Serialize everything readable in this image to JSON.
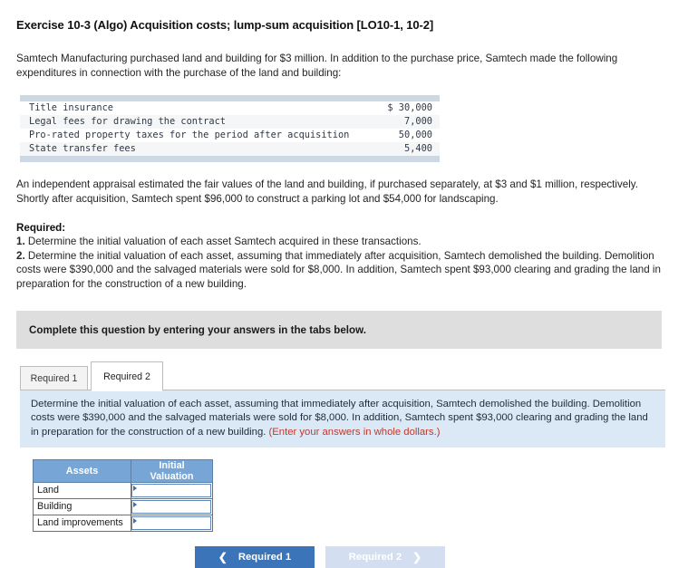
{
  "exercise": {
    "title": "Exercise 10-3 (Algo) Acquisition costs; lump-sum acquisition [LO10-1, 10-2]"
  },
  "intro": {
    "paragraph": "Samtech Manufacturing purchased land and building for $3 million. In addition to the purchase price, Samtech made the following expenditures in connection with the purchase of the land and building:"
  },
  "expenditures_table": {
    "rows": [
      {
        "description": "Title insurance",
        "amount": "$ 30,000"
      },
      {
        "description": "Legal fees for drawing the contract",
        "amount": "7,000"
      },
      {
        "description": "Pro-rated property taxes for the period after acquisition",
        "amount": "50,000"
      },
      {
        "description": "State transfer fees",
        "amount": "5,400"
      }
    ]
  },
  "appraisal": {
    "paragraph": "An independent appraisal estimated the fair values of the land and building, if purchased separately, at $3 and $1 million, respectively. Shortly after acquisition, Samtech spent $96,000 to construct a parking lot and $54,000 for landscaping."
  },
  "required": {
    "heading": "Required:",
    "item1_num": "1.",
    "item1_text": " Determine the initial valuation of each asset Samtech acquired in these transactions.",
    "item2_num": "2.",
    "item2_text": " Determine the initial valuation of each asset, assuming that immediately after acquisition, Samtech demolished the building. Demolition costs were $390,000 and the salvaged materials were sold for $8,000. In addition, Samtech spent $93,000 clearing and grading the land in preparation for the construction of a new building."
  },
  "banner": {
    "text": "Complete this question by entering your answers in the tabs below."
  },
  "tabs": {
    "inactive_label": "Required 1",
    "active_label": "Required 2"
  },
  "instruction_panel": {
    "text": "Determine the initial valuation of each asset, assuming that immediately after acquisition, Samtech demolished the building. Demolition costs were $390,000 and the salvaged materials were sold for $8,000. In addition, Samtech spent $93,000 clearing and grading the land in preparation for the construction of a new building. ",
    "red_note": "(Enter your answers in whole dollars.)"
  },
  "answer_table": {
    "headers": {
      "assets": "Assets",
      "valuation": "Initial Valuation"
    },
    "rows": [
      {
        "asset": "Land",
        "value": ""
      },
      {
        "asset": "Building",
        "value": ""
      },
      {
        "asset": "Land improvements",
        "value": ""
      }
    ]
  },
  "navigation": {
    "prev_label": "Required 1",
    "prev_icon": "chevron-left-icon",
    "next_label": "Required 2",
    "next_icon": "chevron-right-icon"
  },
  "colors": {
    "accent_blue": "#3b74b8",
    "disabled_blue": "#d3dff0",
    "table_header_blue": "#77a6d6",
    "panel_blue": "#dbe8f5",
    "banner_gray": "#dedede",
    "red_note": "#c0392b"
  }
}
